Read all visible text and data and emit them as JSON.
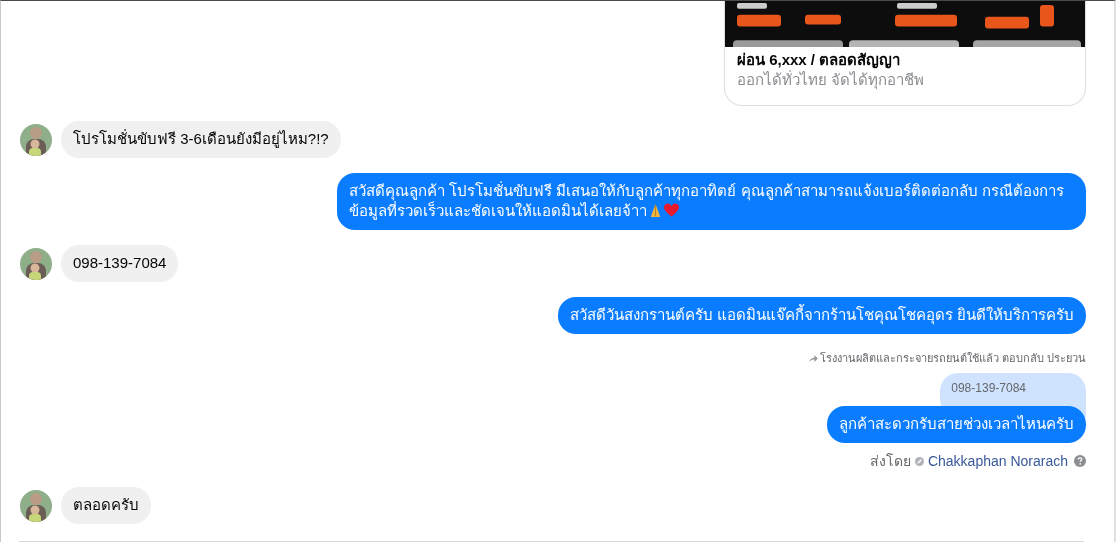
{
  "link_card": {
    "kind": "picture",
    "title": "ผ่อน 6,xxx / ตลอดสัญญา",
    "subtitle": "ออกได้ทั่วไทย จัดได้ทุกอาชีพ"
  },
  "messages": [
    {
      "kind": "incoming",
      "text": "โปรโมชั่นขับฟรี 3-6เดือนยังมีอยู่ไหม?!?"
    },
    {
      "kind": "outgoing",
      "text": "สวัสดีคุณลูกค้า โปรโมชั่นขับฟรี มีเสนอให้กับลูกค้าทุกอาทิตย์ คุณลูกค้าสามารถแจ้งเบอร์ติดต่อกลับ กรณีต้องการข้อมูลที่รวดเร็วและชัดเจนให้แอดมินได้เลยจ้าา",
      "emoji_end": true
    },
    {
      "kind": "incoming",
      "text": "098-139-7084"
    },
    {
      "kind": "outgoing",
      "text": "สวัสดีวันสงกรานต์ครับ แอดมินแจ๊คกี้จากร้านโชคุณโชคอุดร ยินดีให้บริการครับ"
    },
    {
      "kind": "reply",
      "reply_label": "โรงงานผลิตและกระจายรถยนต์ใช้แล้ว ตอบกลับ ประยวน",
      "quoted": "098-139-7084",
      "text": "ลูกค้าสะดวกรับสายช่วงเวลาไหนครับ",
      "sent_by_label": "ส่งโดย",
      "sent_by": "Chakkaphan Norarach"
    },
    {
      "kind": "incoming",
      "text": "ตลอดครับ"
    }
  ]
}
